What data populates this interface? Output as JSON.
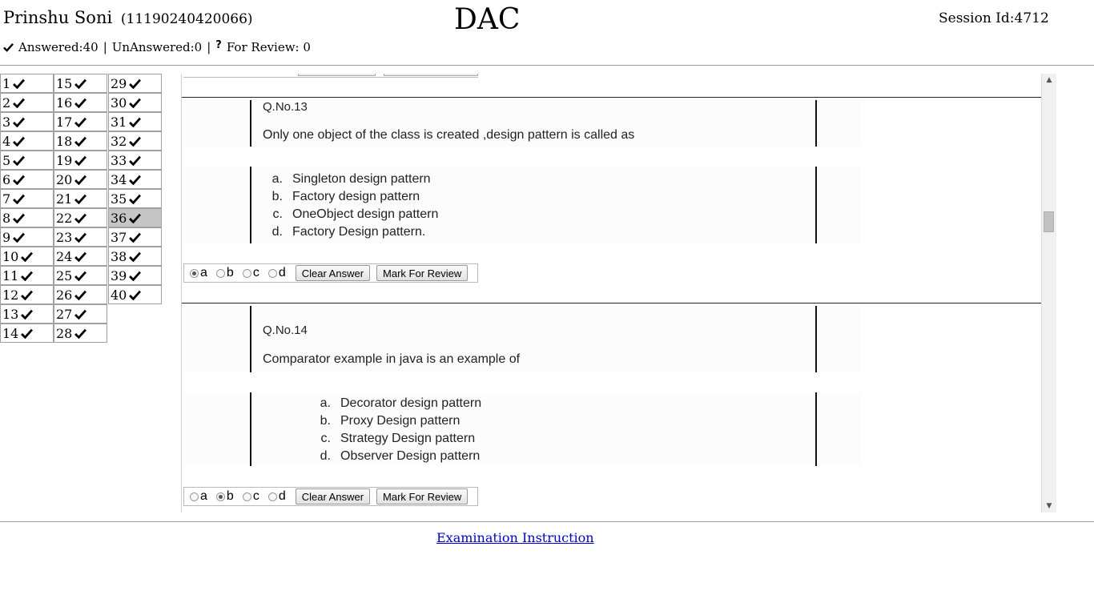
{
  "header": {
    "name": "Prinshu Soni",
    "roll": "(11190240420066)",
    "title": "DAC",
    "session": "Session Id:4712"
  },
  "status": {
    "answered": "Answered:40",
    "unanswered": "UnAnswered:0",
    "review_icon": "?",
    "review": "For Review: 0"
  },
  "grid": {
    "current": "36",
    "columns": [
      [
        "1",
        "2",
        "3",
        "4",
        "5",
        "6",
        "7",
        "8",
        "9",
        "10",
        "11",
        "12",
        "13",
        "14"
      ],
      [
        "15",
        "16",
        "17",
        "18",
        "19",
        "20",
        "21",
        "22",
        "23",
        "24",
        "25",
        "26",
        "27",
        "28"
      ],
      [
        "29",
        "30",
        "31",
        "32",
        "33",
        "34",
        "35",
        "36",
        "37",
        "38",
        "39",
        "40"
      ]
    ]
  },
  "questions": [
    {
      "qno": "Q.No.13",
      "text": "Only one object of the class is created ,design pattern is called as",
      "options": [
        {
          "label": "a.",
          "text": "Singleton design pattern"
        },
        {
          "label": "b.",
          "text": "Factory design pattern"
        },
        {
          "label": "c.",
          "text": "OneObject design pattern"
        },
        {
          "label": "d.",
          "text": "Factory Design pattern."
        }
      ],
      "selected": "a"
    },
    {
      "qno": "Q.No.14",
      "text": "Comparator example in java is an example of",
      "options": [
        {
          "label": "a.",
          "text": "Decorator design pattern"
        },
        {
          "label": "b.",
          "text": "Proxy Design pattern"
        },
        {
          "label": "c.",
          "text": "Strategy Design pattern"
        },
        {
          "label": "d.",
          "text": "Observer Design pattern"
        }
      ],
      "selected": "b"
    }
  ],
  "answer_bar": {
    "choices": [
      "a",
      "b",
      "c",
      "d"
    ],
    "clear_label": "Clear Answer",
    "review_label": "Mark For Review"
  },
  "footer": {
    "instruction_link": "Examination Instruction"
  },
  "icons": {
    "answered": "check-icon",
    "review": "question-mark-icon"
  }
}
